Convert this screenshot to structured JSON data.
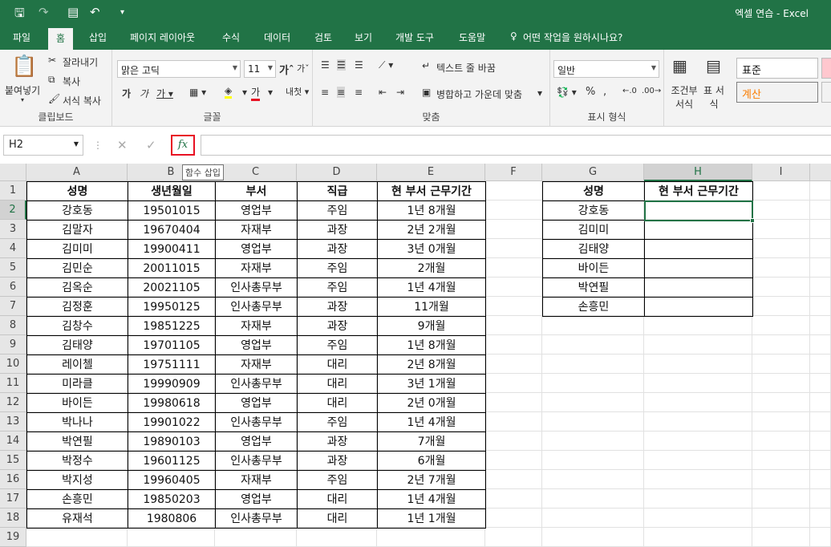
{
  "window": {
    "title": "엑셀 연습 - Excel"
  },
  "ribbon_tabs": [
    "파일",
    "홈",
    "삽입",
    "페이지 레이아웃",
    "수식",
    "데이터",
    "검토",
    "보기",
    "개발 도구",
    "도움말",
    "어떤 작업을 원하시나요?"
  ],
  "ribbon": {
    "paste": "붙여넣기",
    "cut": "잘라내기",
    "copy": "복사",
    "format_painter": "서식 복사",
    "clipboard_label": "클립보드",
    "font_name": "맑은 고딕",
    "font_size": "11",
    "font_label": "글꼴",
    "wrap_text": "텍스트 줄 바꿈",
    "merge_center": "병합하고 가운데 맞춤",
    "align_label": "맞춤",
    "number_format": "일반",
    "number_label": "표시 형식",
    "cond_format": "조건부 서식",
    "table_format": "표 서식",
    "style_normal": "표준",
    "style_calc": "계산"
  },
  "formula_bar": {
    "name_box": "H2",
    "fx": "fx",
    "tooltip": "함수 삽입",
    "formula": ""
  },
  "columns": [
    "A",
    "B",
    "C",
    "D",
    "E",
    "F",
    "G",
    "H",
    "I"
  ],
  "selected_cell": "H2",
  "headers": [
    "성명",
    "생년월일",
    "부서",
    "직급",
    "현 부서 근무기간"
  ],
  "rows": [
    [
      "강호동",
      "19501015",
      "영업부",
      "주임",
      "1년 8개월"
    ],
    [
      "김말자",
      "19670404",
      "자재부",
      "과장",
      "2년 2개월"
    ],
    [
      "김미미",
      "19900411",
      "영업부",
      "과장",
      "3년 0개월"
    ],
    [
      "김민순",
      "20011015",
      "자재부",
      "주임",
      "2개월"
    ],
    [
      "김옥순",
      "20021105",
      "인사총무부",
      "주임",
      "1년 4개월"
    ],
    [
      "김정훈",
      "19950125",
      "인사총무부",
      "과장",
      "11개월"
    ],
    [
      "김창수",
      "19851225",
      "자재부",
      "과장",
      "9개월"
    ],
    [
      "김태양",
      "19701105",
      "영업부",
      "주임",
      "1년 8개월"
    ],
    [
      "레이첼",
      "19751111",
      "자재부",
      "대리",
      "2년 8개월"
    ],
    [
      "미라클",
      "19990909",
      "인사총무부",
      "대리",
      "3년 1개월"
    ],
    [
      "바이든",
      "19980618",
      "영업부",
      "대리",
      "2년 0개월"
    ],
    [
      "박나나",
      "19901022",
      "인사총무부",
      "주임",
      "1년 4개월"
    ],
    [
      "박연필",
      "19890103",
      "영업부",
      "과장",
      "7개월"
    ],
    [
      "박정수",
      "19601125",
      "인사총무부",
      "과장",
      "6개월"
    ],
    [
      "박지성",
      "19960405",
      "자재부",
      "주임",
      "2년 7개월"
    ],
    [
      "손흥민",
      "19850203",
      "영업부",
      "대리",
      "1년 4개월"
    ],
    [
      "유재석",
      "1980806",
      "인사총무부",
      "대리",
      "1년 1개월"
    ]
  ],
  "lookup_headers": [
    "성명",
    "현 부서 근무기간"
  ],
  "lookup_names": [
    "강호동",
    "김미미",
    "김태양",
    "바이든",
    "박연필",
    "손흥민"
  ],
  "row_numbers": [
    "1",
    "2",
    "3",
    "4",
    "5",
    "6",
    "7",
    "8",
    "9",
    "10",
    "11",
    "12",
    "13",
    "14",
    "15",
    "16",
    "17",
    "18",
    "19"
  ]
}
